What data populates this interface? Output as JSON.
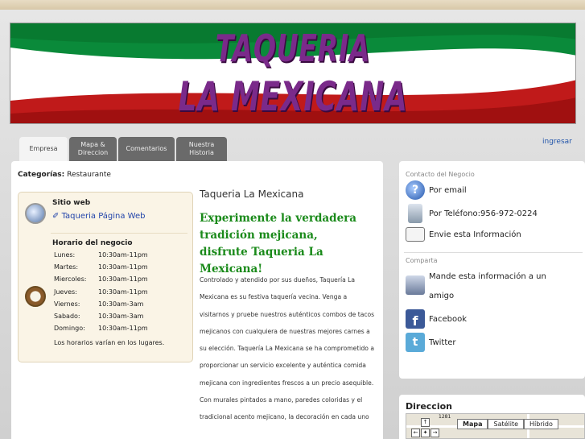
{
  "banner": {
    "line1": "TAQUERIA",
    "line2": "LA MEXICANA"
  },
  "tabs": [
    {
      "label": "Empresa",
      "active": true
    },
    {
      "label": "Mapa & Direccion",
      "active": false
    },
    {
      "label": "Comentarios",
      "active": false
    },
    {
      "label": "Nuestra Historia",
      "active": false
    }
  ],
  "login_label": "ingresar",
  "categories": {
    "label": "Categorías:",
    "value": "Restaurante"
  },
  "website": {
    "title": "Sitio web",
    "link": "Taqueria Página Web"
  },
  "hours": {
    "title": "Horario del negocio",
    "rows": [
      {
        "day": "Lunes:",
        "time": "10:30am-11pm"
      },
      {
        "day": "Martes:",
        "time": "10:30am-11pm"
      },
      {
        "day": "Miercoles:",
        "time": "10:30am-11pm"
      },
      {
        "day": "Jueves:",
        "time": "10:30am-11pm"
      },
      {
        "day": "Viernes:",
        "time": "10:30am-3am"
      },
      {
        "day": "Sabado:",
        "time": "10:30am-3am"
      },
      {
        "day": "Domingo:",
        "time": "10:30am-11pm"
      }
    ],
    "note": "Los horarios varían en los lugares."
  },
  "business_title": "Taqueria La Mexicana",
  "tagline": [
    "Experimente la verdadera",
    "tradición mejicana,",
    "disfrute Taqueria La Mexicana!"
  ],
  "body_text": "Controlado y atendido por sus dueños, Taquería La Mexicana es su festiva taquería vecina. Venga a visitarnos y pruebe nuestros auténticos combos de tacos mejicanos con cualquiera de nuestras mejores carnes a su elección. Taquería La Mexicana se ha comprometido a proporcionar un servicio excelente y auténtica comida mejicana con ingredientes frescos a un precio asequible. Con murales pintados a mano, paredes coloridas y el tradicional acento mejicano, la decoración en cada uno",
  "sidebar": {
    "contact_heading": "Contacto del Negocio",
    "email": "Por email",
    "phone": "Por Teléfono:956-972-0224",
    "send_info": "Envie esta Información",
    "share_heading": "Comparta",
    "send_friend": "Mande esta información a un amigo",
    "facebook": "Facebook",
    "twitter": "Twitter"
  },
  "map": {
    "title": "Direccion",
    "road_label": "1281",
    "buttons": [
      "Mapa",
      "Satélite",
      "Híbrido"
    ],
    "selected": "Mapa"
  },
  "colors": {
    "tagline_green": "#1a8a1a",
    "link_blue": "#2244aa",
    "tab_gray": "#6a6a6a",
    "banner_purple": "#7a2a8a"
  }
}
